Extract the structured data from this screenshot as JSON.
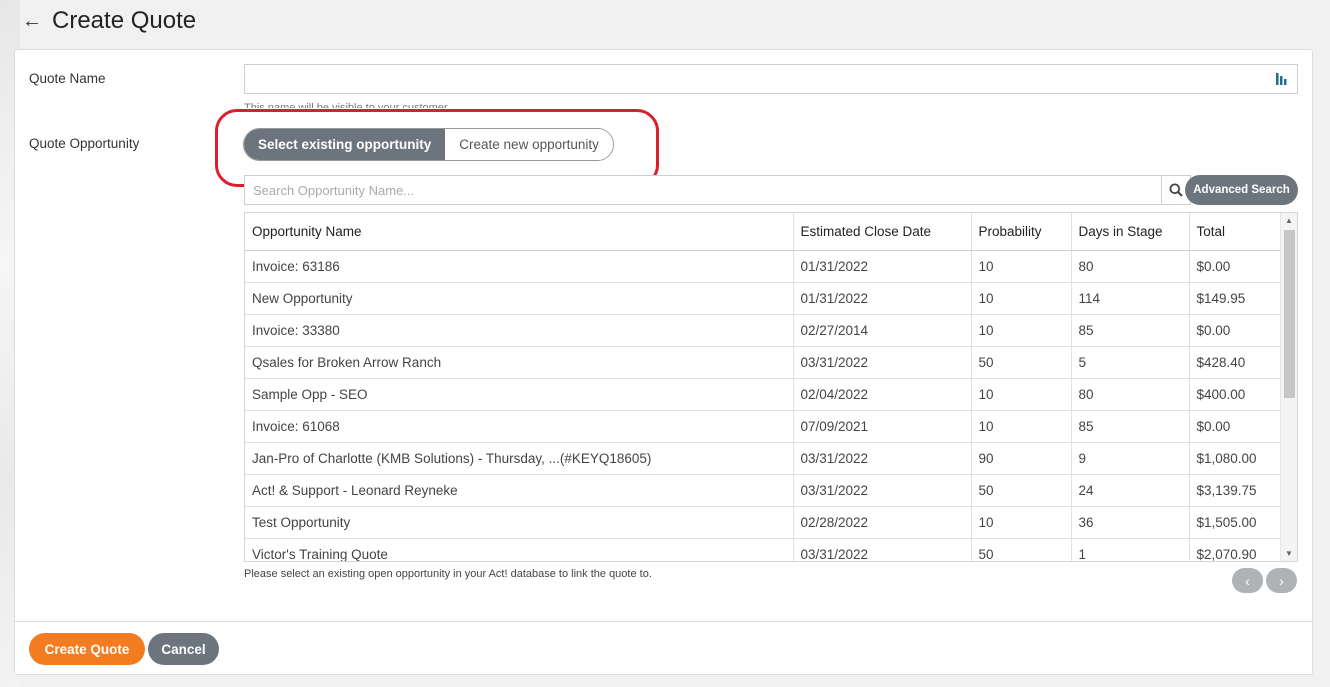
{
  "header": {
    "back_icon": "arrow-left-icon",
    "title": "Create Quote"
  },
  "form": {
    "quote_name_label": "Quote Name",
    "quote_name_value": "",
    "quote_name_hint": "This name will be visible to your customer.",
    "quote_opportunity_label": "Quote Opportunity",
    "toggle": {
      "select_existing": "Select existing opportunity",
      "create_new": "Create new opportunity",
      "active": "select_existing"
    },
    "search_placeholder": "Search Opportunity Name...",
    "advanced_search": "Advanced Search",
    "table_hint": "Please select an existing open opportunity in your Act! database to link the quote to."
  },
  "table": {
    "columns": [
      "Opportunity Name",
      "Estimated Close Date",
      "Probability",
      "Days in Stage",
      "Total"
    ],
    "rows": [
      [
        "Invoice: 63186",
        "01/31/2022",
        "10",
        "80",
        "$0.00"
      ],
      [
        "New Opportunity",
        "01/31/2022",
        "10",
        "114",
        "$149.95"
      ],
      [
        "Invoice: 33380",
        "02/27/2014",
        "10",
        "85",
        "$0.00"
      ],
      [
        "Qsales for Broken Arrow Ranch",
        "03/31/2022",
        "50",
        "5",
        "$428.40"
      ],
      [
        "Sample Opp - SEO",
        "02/04/2022",
        "10",
        "80",
        "$400.00"
      ],
      [
        "Invoice: 61068",
        "07/09/2021",
        "10",
        "85",
        "$0.00"
      ],
      [
        "Jan-Pro of Charlotte (KMB Solutions) - Thursday, ...(#KEYQ18605)",
        "03/31/2022",
        "90",
        "9",
        "$1,080.00"
      ],
      [
        "Act! & Support - Leonard Reyneke",
        "03/31/2022",
        "50",
        "24",
        "$3,139.75"
      ],
      [
        "Test Opportunity",
        "02/28/2022",
        "10",
        "36",
        "$1,505.00"
      ],
      [
        "Victor's Training Quote",
        "03/31/2022",
        "50",
        "1",
        "$2,070.90"
      ]
    ]
  },
  "footer": {
    "create_label": "Create Quote",
    "cancel_label": "Cancel"
  },
  "colors": {
    "accent": "#f47c20",
    "secondary": "#6c757d",
    "highlight": "#d9202c"
  }
}
